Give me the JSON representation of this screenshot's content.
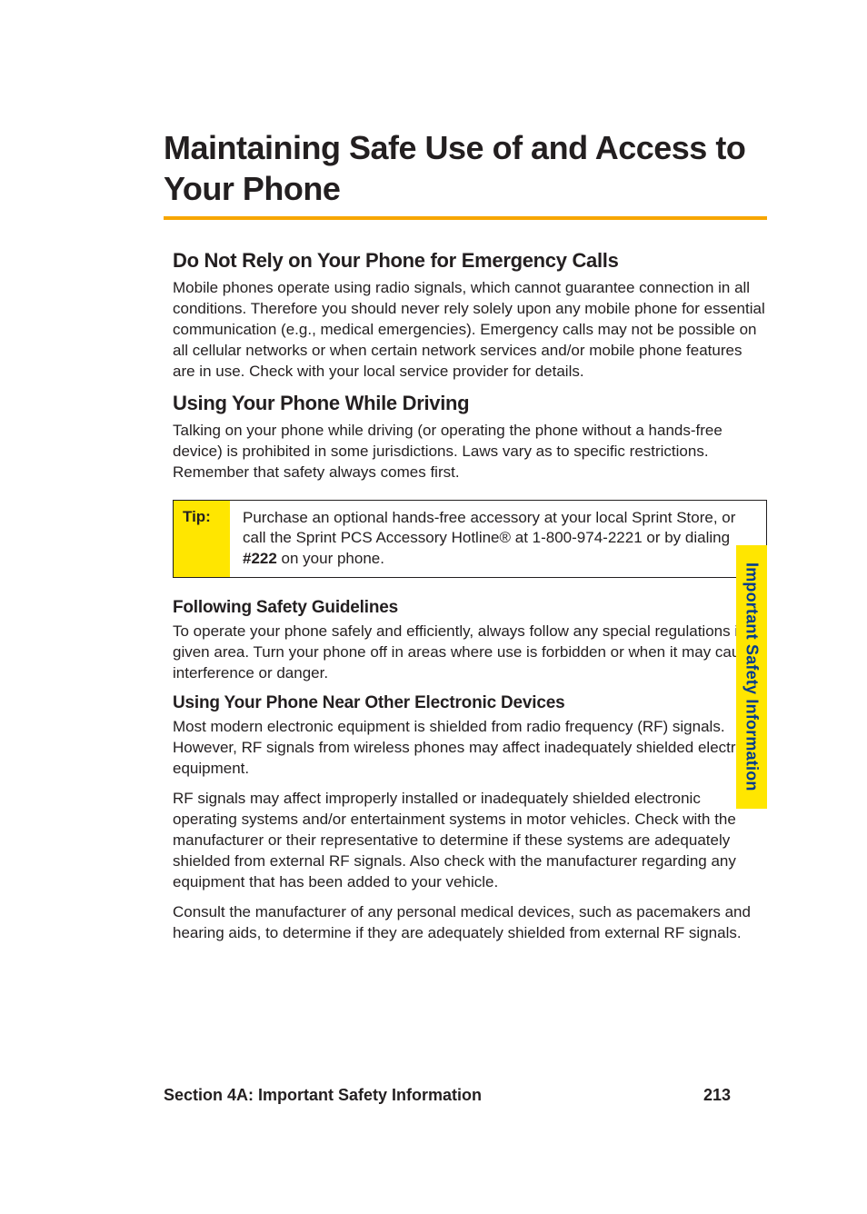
{
  "title": "Maintaining Safe Use of and Access to Your Phone",
  "sections": {
    "s1": {
      "head": "Do Not Rely on Your Phone for Emergency Calls",
      "body": "Mobile phones operate using radio signals, which cannot guarantee connection in all conditions. Therefore you should never rely solely upon any mobile phone for essential communication (e.g., medical emergencies). Emergency calls may not be possible on all cellular networks or when certain network services and/or mobile phone features are in use. Check with your local service provider for details."
    },
    "s2": {
      "head": "Using Your Phone While Driving",
      "body": "Talking on your phone while driving (or operating the phone without a hands-free device) is prohibited in some jurisdictions. Laws vary as to specific restrictions. Remember that safety always comes first."
    },
    "tip": {
      "label": "Tip:",
      "text_before": "Purchase an optional hands-free accessory at your local Sprint Store, or call the Sprint PCS Accessory Hotline® at 1-800-974-2221 or by dialing ",
      "bold": "#222",
      "text_after": " on your phone."
    },
    "s3": {
      "head": "Following Safety Guidelines",
      "body": "To operate your phone safely and efficiently, always follow any special regulations in a given area. Turn your phone off in areas where use is forbidden or when it may cause interference or danger."
    },
    "s4": {
      "head": "Using Your Phone Near Other Electronic Devices",
      "p1": "Most modern electronic equipment is shielded from radio frequency (RF) signals. However, RF signals from wireless phones may affect inadequately shielded electronic equipment.",
      "p2": "RF signals may affect improperly installed or inadequately shielded electronic operating systems and/or entertainment systems in motor vehicles. Check with the manufacturer or their representative to determine if these systems are adequately shielded from external RF signals. Also check with the manufacturer regarding any equipment that has been added to your vehicle.",
      "p3": "Consult the manufacturer of any personal medical devices, such as pacemakers and hearing aids, to determine if they are adequately shielded from external RF signals."
    }
  },
  "side_tab": "Important Safety Information",
  "footer": {
    "left": "Section 4A: Important Safety Information",
    "right": "213"
  }
}
